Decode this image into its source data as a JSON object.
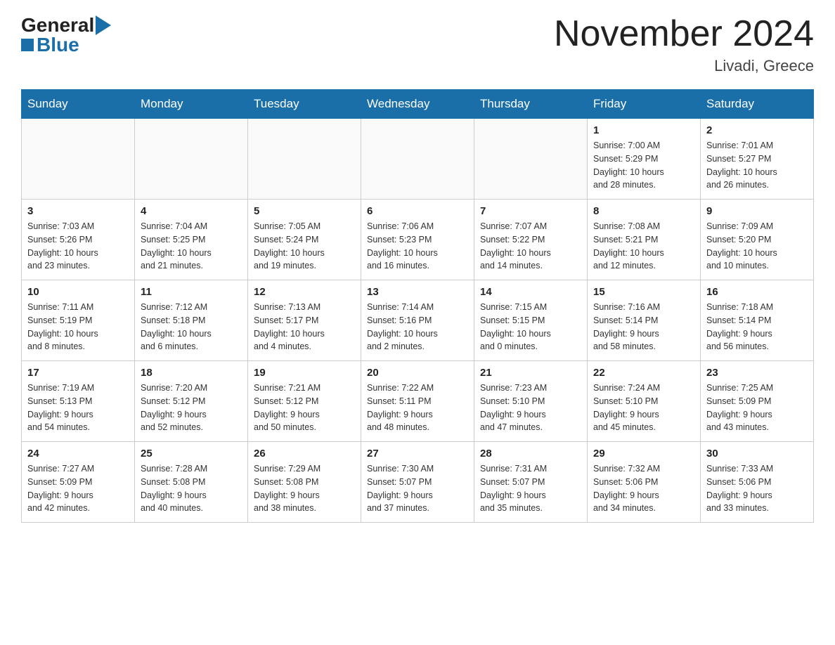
{
  "header": {
    "logo_general": "General",
    "logo_blue": "Blue",
    "month_title": "November 2024",
    "location": "Livadi, Greece"
  },
  "weekdays": [
    "Sunday",
    "Monday",
    "Tuesday",
    "Wednesday",
    "Thursday",
    "Friday",
    "Saturday"
  ],
  "weeks": [
    [
      {
        "day": "",
        "info": ""
      },
      {
        "day": "",
        "info": ""
      },
      {
        "day": "",
        "info": ""
      },
      {
        "day": "",
        "info": ""
      },
      {
        "day": "",
        "info": ""
      },
      {
        "day": "1",
        "info": "Sunrise: 7:00 AM\nSunset: 5:29 PM\nDaylight: 10 hours\nand 28 minutes."
      },
      {
        "day": "2",
        "info": "Sunrise: 7:01 AM\nSunset: 5:27 PM\nDaylight: 10 hours\nand 26 minutes."
      }
    ],
    [
      {
        "day": "3",
        "info": "Sunrise: 7:03 AM\nSunset: 5:26 PM\nDaylight: 10 hours\nand 23 minutes."
      },
      {
        "day": "4",
        "info": "Sunrise: 7:04 AM\nSunset: 5:25 PM\nDaylight: 10 hours\nand 21 minutes."
      },
      {
        "day": "5",
        "info": "Sunrise: 7:05 AM\nSunset: 5:24 PM\nDaylight: 10 hours\nand 19 minutes."
      },
      {
        "day": "6",
        "info": "Sunrise: 7:06 AM\nSunset: 5:23 PM\nDaylight: 10 hours\nand 16 minutes."
      },
      {
        "day": "7",
        "info": "Sunrise: 7:07 AM\nSunset: 5:22 PM\nDaylight: 10 hours\nand 14 minutes."
      },
      {
        "day": "8",
        "info": "Sunrise: 7:08 AM\nSunset: 5:21 PM\nDaylight: 10 hours\nand 12 minutes."
      },
      {
        "day": "9",
        "info": "Sunrise: 7:09 AM\nSunset: 5:20 PM\nDaylight: 10 hours\nand 10 minutes."
      }
    ],
    [
      {
        "day": "10",
        "info": "Sunrise: 7:11 AM\nSunset: 5:19 PM\nDaylight: 10 hours\nand 8 minutes."
      },
      {
        "day": "11",
        "info": "Sunrise: 7:12 AM\nSunset: 5:18 PM\nDaylight: 10 hours\nand 6 minutes."
      },
      {
        "day": "12",
        "info": "Sunrise: 7:13 AM\nSunset: 5:17 PM\nDaylight: 10 hours\nand 4 minutes."
      },
      {
        "day": "13",
        "info": "Sunrise: 7:14 AM\nSunset: 5:16 PM\nDaylight: 10 hours\nand 2 minutes."
      },
      {
        "day": "14",
        "info": "Sunrise: 7:15 AM\nSunset: 5:15 PM\nDaylight: 10 hours\nand 0 minutes."
      },
      {
        "day": "15",
        "info": "Sunrise: 7:16 AM\nSunset: 5:14 PM\nDaylight: 9 hours\nand 58 minutes."
      },
      {
        "day": "16",
        "info": "Sunrise: 7:18 AM\nSunset: 5:14 PM\nDaylight: 9 hours\nand 56 minutes."
      }
    ],
    [
      {
        "day": "17",
        "info": "Sunrise: 7:19 AM\nSunset: 5:13 PM\nDaylight: 9 hours\nand 54 minutes."
      },
      {
        "day": "18",
        "info": "Sunrise: 7:20 AM\nSunset: 5:12 PM\nDaylight: 9 hours\nand 52 minutes."
      },
      {
        "day": "19",
        "info": "Sunrise: 7:21 AM\nSunset: 5:12 PM\nDaylight: 9 hours\nand 50 minutes."
      },
      {
        "day": "20",
        "info": "Sunrise: 7:22 AM\nSunset: 5:11 PM\nDaylight: 9 hours\nand 48 minutes."
      },
      {
        "day": "21",
        "info": "Sunrise: 7:23 AM\nSunset: 5:10 PM\nDaylight: 9 hours\nand 47 minutes."
      },
      {
        "day": "22",
        "info": "Sunrise: 7:24 AM\nSunset: 5:10 PM\nDaylight: 9 hours\nand 45 minutes."
      },
      {
        "day": "23",
        "info": "Sunrise: 7:25 AM\nSunset: 5:09 PM\nDaylight: 9 hours\nand 43 minutes."
      }
    ],
    [
      {
        "day": "24",
        "info": "Sunrise: 7:27 AM\nSunset: 5:09 PM\nDaylight: 9 hours\nand 42 minutes."
      },
      {
        "day": "25",
        "info": "Sunrise: 7:28 AM\nSunset: 5:08 PM\nDaylight: 9 hours\nand 40 minutes."
      },
      {
        "day": "26",
        "info": "Sunrise: 7:29 AM\nSunset: 5:08 PM\nDaylight: 9 hours\nand 38 minutes."
      },
      {
        "day": "27",
        "info": "Sunrise: 7:30 AM\nSunset: 5:07 PM\nDaylight: 9 hours\nand 37 minutes."
      },
      {
        "day": "28",
        "info": "Sunrise: 7:31 AM\nSunset: 5:07 PM\nDaylight: 9 hours\nand 35 minutes."
      },
      {
        "day": "29",
        "info": "Sunrise: 7:32 AM\nSunset: 5:06 PM\nDaylight: 9 hours\nand 34 minutes."
      },
      {
        "day": "30",
        "info": "Sunrise: 7:33 AM\nSunset: 5:06 PM\nDaylight: 9 hours\nand 33 minutes."
      }
    ]
  ]
}
